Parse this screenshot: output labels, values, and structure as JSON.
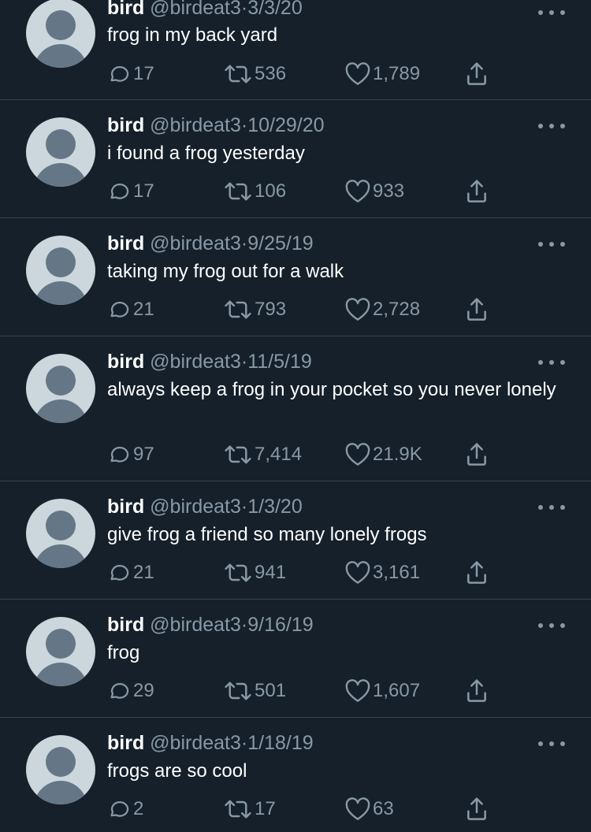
{
  "tweets": [
    {
      "name": "bird",
      "handle": "@birdeat3",
      "separator": "·",
      "date": "3/3/20",
      "text": "frog in my back yard",
      "replies": "17",
      "retweets": "536",
      "likes": "1,789"
    },
    {
      "name": "bird",
      "handle": "@birdeat3",
      "separator": "·",
      "date": "10/29/20",
      "text": "i found a frog yesterday",
      "replies": "17",
      "retweets": "106",
      "likes": "933"
    },
    {
      "name": "bird",
      "handle": "@birdeat3",
      "separator": "·",
      "date": "9/25/19",
      "text": "taking my frog out for a walk",
      "replies": "21",
      "retweets": "793",
      "likes": "2,728"
    },
    {
      "name": "bird",
      "handle": "@birdeat3",
      "separator": "·",
      "date": "11/5/19",
      "text": "always keep a frog in your pocket so you never lonely",
      "replies": "97",
      "retweets": "7,414",
      "likes": "21.9K"
    },
    {
      "name": "bird",
      "handle": "@birdeat3",
      "separator": "·",
      "date": "1/3/20",
      "text": "give frog a friend so many lonely frogs",
      "replies": "21",
      "retweets": "941",
      "likes": "3,161"
    },
    {
      "name": "bird",
      "handle": "@birdeat3",
      "separator": "·",
      "date": "9/16/19",
      "text": "frog",
      "replies": "29",
      "retweets": "501",
      "likes": "1,607"
    },
    {
      "name": "bird",
      "handle": "@birdeat3",
      "separator": "·",
      "date": "1/18/19",
      "text": "frogs are so cool",
      "replies": "2",
      "retweets": "17",
      "likes": "63"
    }
  ],
  "icons": {
    "reply": "reply-icon",
    "retweet": "retweet-icon",
    "like": "like-icon",
    "share": "share-icon",
    "more": "more-icon",
    "avatar": "default-avatar-icon"
  },
  "colors": {
    "background": "#15202b",
    "divider": "#38444d",
    "primary_text": "#ffffff",
    "secondary_text": "#8899a6",
    "avatar_bg": "#ccd6dd",
    "avatar_fg": "#657786"
  }
}
